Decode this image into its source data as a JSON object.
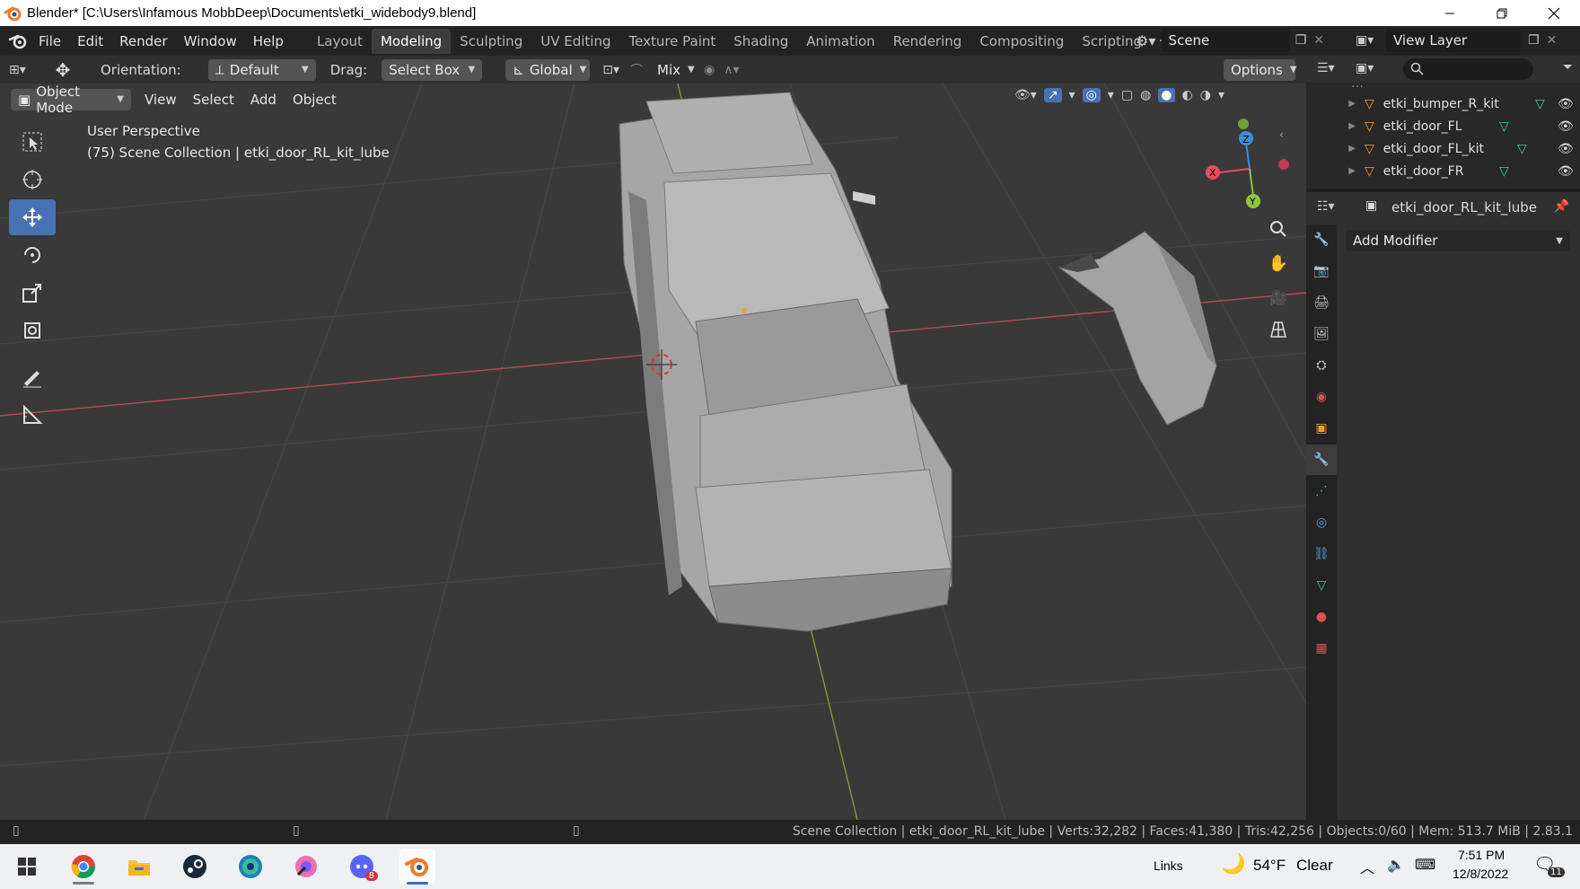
{
  "window": {
    "title": "Blender* [C:\\Users\\Infamous MobbDeep\\Documents\\etki_widebody9.blend]"
  },
  "menu": [
    "File",
    "Edit",
    "Render",
    "Window",
    "Help"
  ],
  "workspaces": {
    "tabs": [
      "Layout",
      "Modeling",
      "Sculpting",
      "UV Editing",
      "Texture Paint",
      "Shading",
      "Animation",
      "Rendering",
      "Compositing",
      "Scripting"
    ],
    "active": "Modeling"
  },
  "scene": {
    "name": "Scene"
  },
  "view_layer": {
    "name": "View Layer"
  },
  "tool_header": {
    "orientation_label": "Orientation:",
    "orientation_value": "Default",
    "drag_label": "Drag:",
    "drag_value": "Select Box",
    "transform_orientation": "Global",
    "proportional_mix": "Mix",
    "options_label": "Options"
  },
  "viewport_header": {
    "mode": "Object Mode",
    "menus": [
      "View",
      "Select",
      "Add",
      "Object"
    ]
  },
  "viewport": {
    "perspective_label": "User Perspective",
    "collection_label": "(75) Scene Collection | etki_door_RL_kit_lube"
  },
  "outliner": {
    "items": [
      {
        "name": "etki_bumper_R_kit"
      },
      {
        "name": "etki_door_FL"
      },
      {
        "name": "etki_door_FL_kit"
      },
      {
        "name": "etki_door_FR"
      }
    ]
  },
  "properties": {
    "object_name": "etki_door_RL_kit_lube",
    "add_modifier": "Add Modifier"
  },
  "statusbar": {
    "text": "Scene Collection | etki_door_RL_kit_lube | Verts:32,282 | Faces:41,380 | Tris:42,256 | Objects:0/60 | Mem: 513.7 MiB | 2.83.1"
  },
  "taskbar": {
    "links_label": "Links",
    "weather_temp": "54°F",
    "weather_cond": "Clear",
    "time": "7:51 PM",
    "date": "12/8/2022",
    "notif_count": "11",
    "discord_badge": "8"
  },
  "colors": {
    "accent": "#4772b3",
    "x_axis": "#e84a5f",
    "y_axis": "#8cc63f",
    "z_axis": "#3b8fd8"
  }
}
